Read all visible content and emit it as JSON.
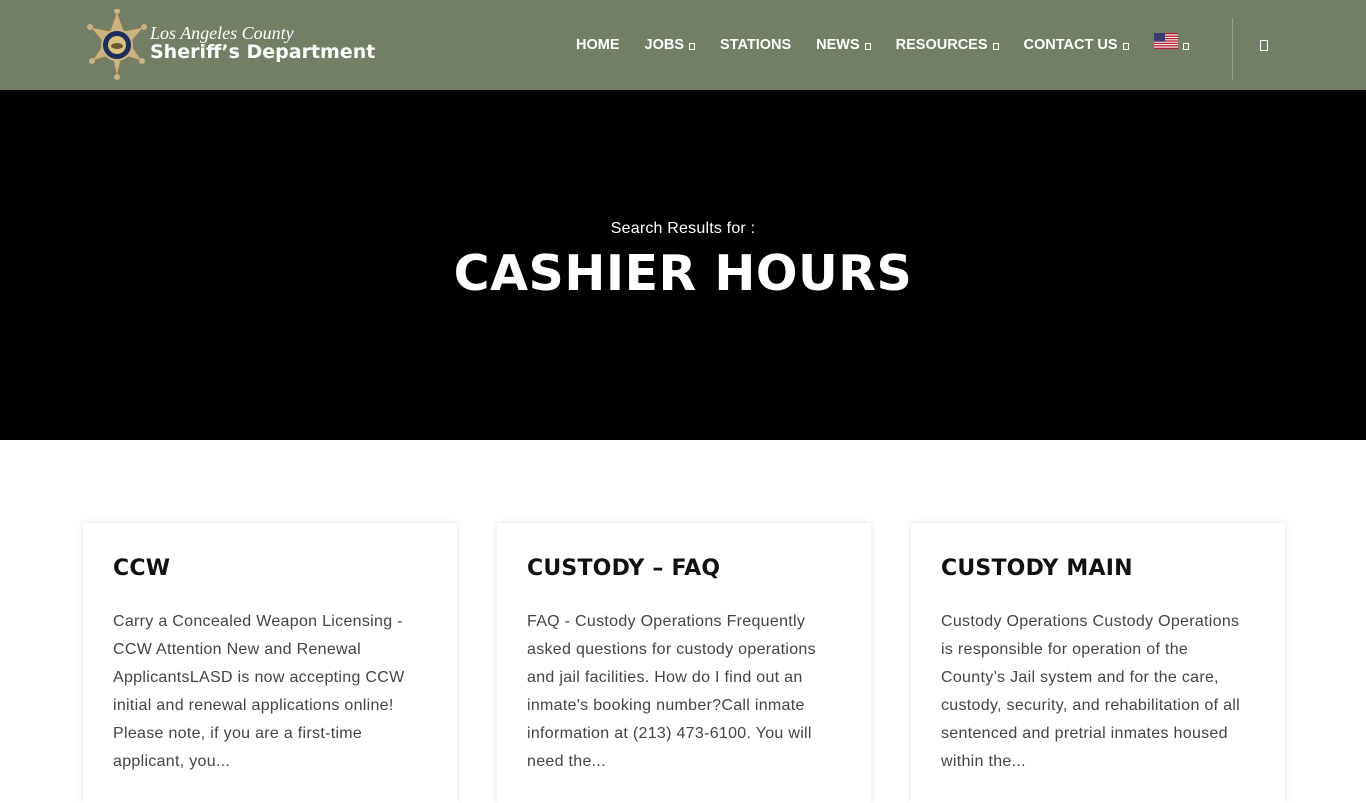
{
  "header": {
    "logo": {
      "line1": "Los Angeles County",
      "line2": "Sheriff’s Department",
      "badge_icon": "sheriff-star-badge-icon",
      "colors": {
        "badge_gold": "#c9b483",
        "badge_center": "#1f2d5a"
      }
    },
    "nav": [
      {
        "label": "HOME",
        "has_dropdown": false
      },
      {
        "label": "JOBS",
        "has_dropdown": true
      },
      {
        "label": "STATIONS",
        "has_dropdown": false
      },
      {
        "label": "NEWS",
        "has_dropdown": true
      },
      {
        "label": "RESOURCES",
        "has_dropdown": true
      },
      {
        "label": "CONTACT US",
        "has_dropdown": true
      }
    ],
    "language_icon": "us-flag-icon",
    "search_icon": "search-icon",
    "colors": {
      "background": "#727e65",
      "text": "#ffffff"
    }
  },
  "hero": {
    "subtitle": "Search Results for :",
    "title": "CASHIER HOURS",
    "colors": {
      "background": "#000000",
      "text": "#ffffff"
    }
  },
  "results": [
    {
      "title": "CCW",
      "excerpt": "Carry a Concealed Weapon Licensing - CCW Attention New and Renewal ApplicantsLASD is now accepting CCW initial and renewal applications online! Please note, if you are a first-time applicant, you..."
    },
    {
      "title": "CUSTODY – FAQ",
      "excerpt": "FAQ - Custody Operations Frequently asked questions for custody operations and jail facilities. How do I find out an inmate's booking number?Call inmate information at (213) 473-6100. You will need the..."
    },
    {
      "title": "CUSTODY MAIN",
      "excerpt": "Custody Operations Custody Operations is responsible for operation of the County’s Jail system and for the care, custody, security, and rehabilitation of all sentenced and pretrial inmates housed within the..."
    }
  ]
}
